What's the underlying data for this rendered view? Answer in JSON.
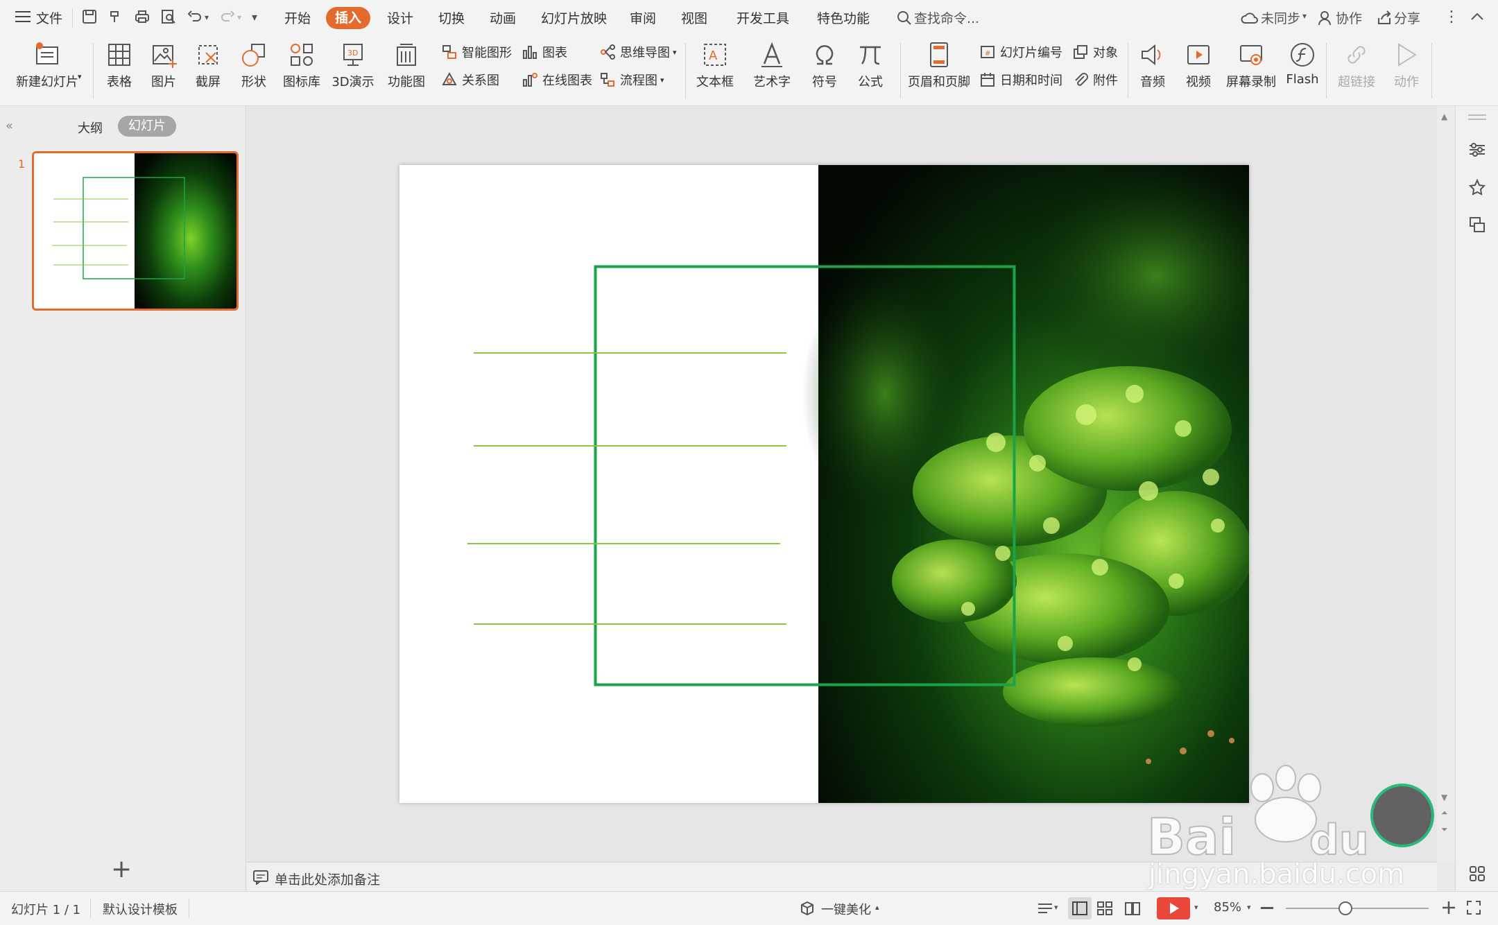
{
  "menu": {
    "file": "文件",
    "tabs": [
      "开始",
      "插入",
      "设计",
      "切换",
      "动画",
      "幻灯片放映",
      "审阅",
      "视图",
      "开发工具",
      "特色功能"
    ],
    "active_tab": "插入",
    "search_placeholder": "查找命令...",
    "sync": "未同步",
    "collab": "协作",
    "share": "分享"
  },
  "ribbon": {
    "new_slide": "新建幻灯片",
    "table": "表格",
    "picture": "图片",
    "screenshot": "截屏",
    "shape": "形状",
    "icon_lib": "图标库",
    "demo3d": "3D演示",
    "func_chart": "功能图",
    "smart_art": "智能图形",
    "chart": "图表",
    "mindmap": "思维导图",
    "relation": "关系图",
    "online_chart": "在线图表",
    "flowchart": "流程图",
    "textbox": "文本框",
    "wordart": "艺术字",
    "symbol": "符号",
    "formula": "公式",
    "header_footer": "页眉和页脚",
    "slide_number": "幻灯片编号",
    "object": "对象",
    "datetime": "日期和时间",
    "attachment": "附件",
    "audio": "音频",
    "video": "视频",
    "screen_record": "屏幕录制",
    "flash": "Flash",
    "hyperlink": "超链接",
    "action": "动作"
  },
  "left_panel": {
    "outline_tab": "大纲",
    "slides_tab": "幻灯片",
    "slide_index": "1",
    "add": "+"
  },
  "notes": {
    "placeholder": "单击此处添加备注"
  },
  "status": {
    "slide_count": "幻灯片 1 / 1",
    "template": "默认设计模板",
    "beautify": "一键美化",
    "zoom": "85%"
  },
  "watermark": {
    "url_text": "jingyan.baidu.com"
  },
  "colors": {
    "accent": "#e46b2e",
    "frame_green": "#1aa34a",
    "line_green": "#8cc63f"
  }
}
